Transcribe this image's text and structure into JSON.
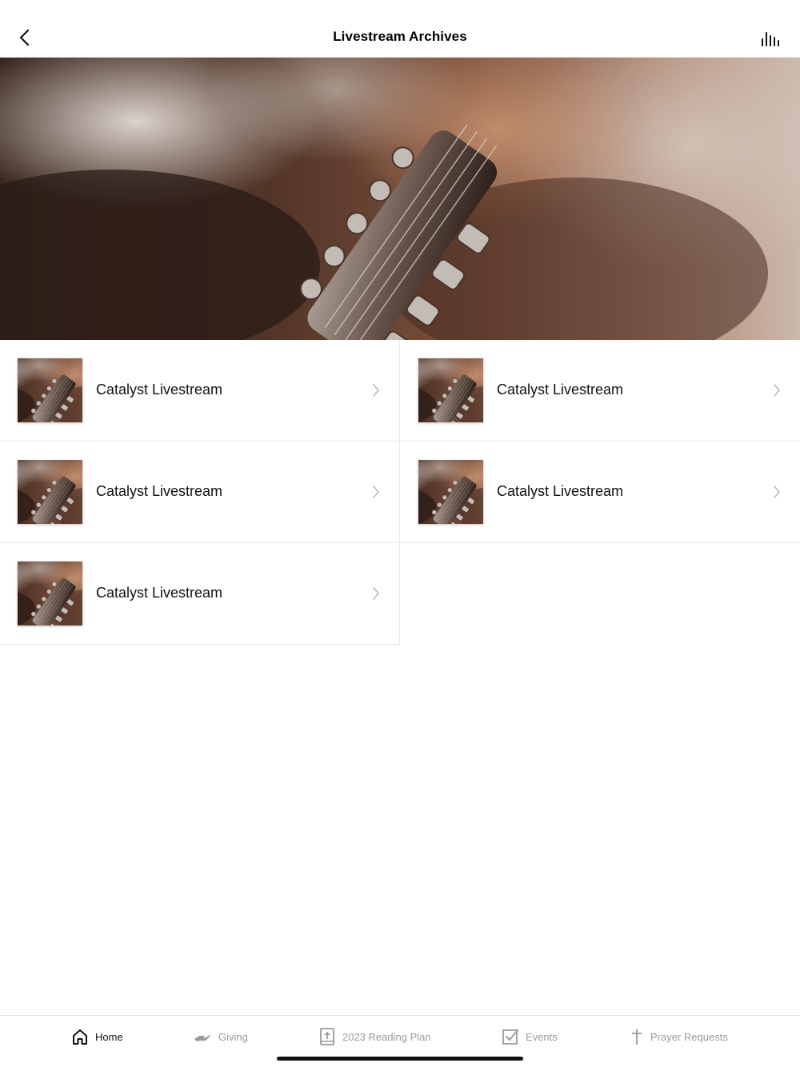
{
  "header": {
    "title": "Livestream Archives",
    "back_icon": "chevron-left-icon",
    "audio_icon": "audio-bars-icon"
  },
  "hero": {
    "image": "guitar-headstock-photo"
  },
  "items": [
    {
      "label": "Catalyst Livestream"
    },
    {
      "label": "Catalyst Livestream"
    },
    {
      "label": "Catalyst Livestream"
    },
    {
      "label": "Catalyst Livestream"
    },
    {
      "label": "Catalyst Livestream"
    }
  ],
  "tabbar": {
    "tabs": [
      {
        "label": "Home",
        "icon": "home-icon",
        "active": true
      },
      {
        "label": "Giving",
        "icon": "giving-hand-icon",
        "active": false
      },
      {
        "label": "2023 Reading Plan",
        "icon": "bible-icon",
        "active": false
      },
      {
        "label": "Events",
        "icon": "checkbox-icon",
        "active": false
      },
      {
        "label": "Prayer Requests",
        "icon": "cross-icon",
        "active": false
      }
    ]
  },
  "colors": {
    "accent": "#111111",
    "inactive": "#9a9a9a",
    "divider": "#e6e6e6"
  }
}
